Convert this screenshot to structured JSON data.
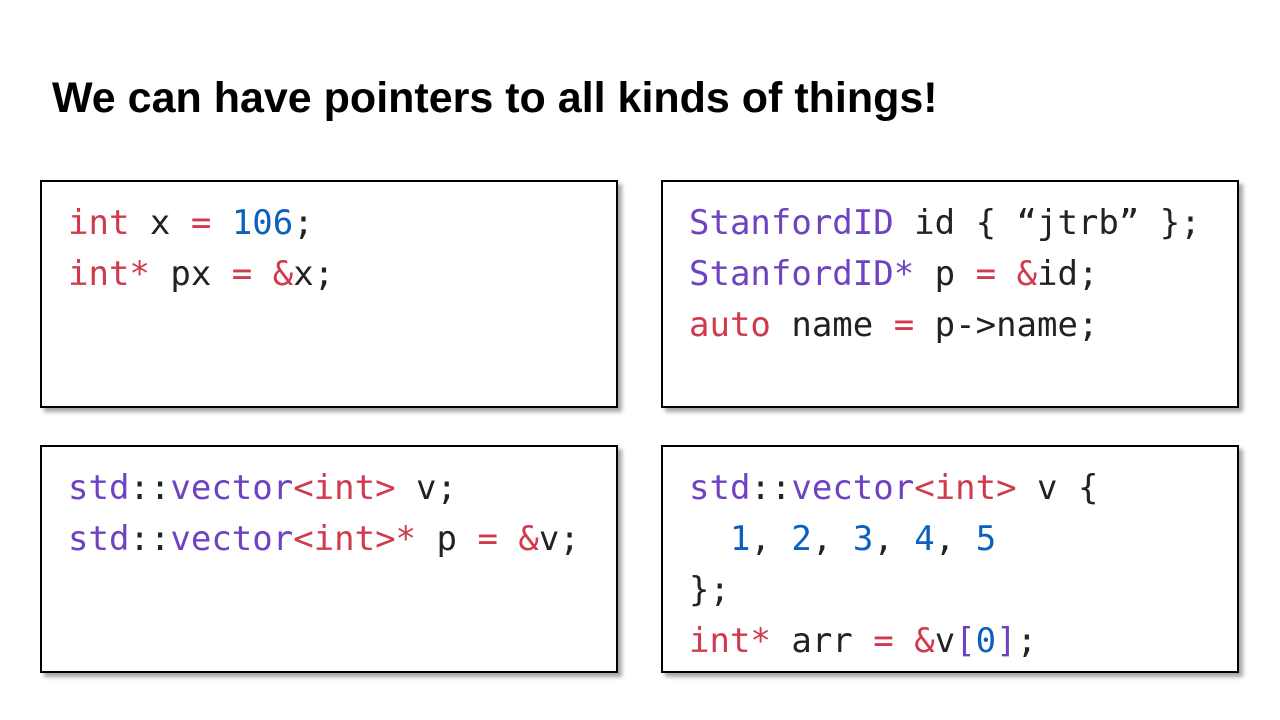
{
  "title": "We can have pointers to all kinds of things!",
  "colors": {
    "keyword": "#cf3a4c",
    "number": "#0b5fbe",
    "type": "#6f42c1",
    "plain": "#222222"
  },
  "boxes": [
    {
      "lines": [
        [
          [
            "int",
            "kw"
          ],
          [
            " x ",
            "plain"
          ],
          [
            "=",
            "kw"
          ],
          [
            " ",
            "plain"
          ],
          [
            "106",
            "num"
          ],
          [
            ";",
            "plain"
          ]
        ],
        [
          [
            "int*",
            "kw"
          ],
          [
            " px ",
            "plain"
          ],
          [
            "=",
            "kw"
          ],
          [
            " ",
            "plain"
          ],
          [
            "&",
            "kw"
          ],
          [
            "x;",
            "plain"
          ]
        ]
      ]
    },
    {
      "lines": [
        [
          [
            "StanfordID",
            "type"
          ],
          [
            " id { “jtrb” };",
            "plain"
          ]
        ],
        [
          [
            "StanfordID*",
            "type"
          ],
          [
            " p ",
            "plain"
          ],
          [
            "=",
            "kw"
          ],
          [
            " ",
            "plain"
          ],
          [
            "&",
            "kw"
          ],
          [
            "id;",
            "plain"
          ]
        ],
        [
          [
            "auto",
            "kw"
          ],
          [
            " name ",
            "plain"
          ],
          [
            "=",
            "kw"
          ],
          [
            " p->name;",
            "plain"
          ]
        ]
      ]
    },
    {
      "lines": [
        [
          [
            "std",
            "type"
          ],
          [
            "::",
            "plain"
          ],
          [
            "vector",
            "type"
          ],
          [
            "<int>",
            "kw"
          ],
          [
            " v;",
            "plain"
          ]
        ],
        [
          [
            "std",
            "type"
          ],
          [
            "::",
            "plain"
          ],
          [
            "vector",
            "type"
          ],
          [
            "<int>*",
            "kw"
          ],
          [
            " p ",
            "plain"
          ],
          [
            "=",
            "kw"
          ],
          [
            " ",
            "plain"
          ],
          [
            "&",
            "kw"
          ],
          [
            "v;",
            "plain"
          ]
        ]
      ]
    },
    {
      "lines": [
        [
          [
            "std",
            "type"
          ],
          [
            "::",
            "plain"
          ],
          [
            "vector",
            "type"
          ],
          [
            "<int>",
            "kw"
          ],
          [
            " v {",
            "plain"
          ]
        ],
        [
          [
            "  ",
            "plain"
          ],
          [
            "1",
            "num"
          ],
          [
            ", ",
            "plain"
          ],
          [
            "2",
            "num"
          ],
          [
            ", ",
            "plain"
          ],
          [
            "3",
            "num"
          ],
          [
            ", ",
            "plain"
          ],
          [
            "4",
            "num"
          ],
          [
            ", ",
            "plain"
          ],
          [
            "5",
            "num"
          ]
        ],
        [
          [
            "};",
            "plain"
          ]
        ],
        [
          [
            "int*",
            "kw"
          ],
          [
            " arr ",
            "plain"
          ],
          [
            "=",
            "kw"
          ],
          [
            " ",
            "plain"
          ],
          [
            "&",
            "kw"
          ],
          [
            "v",
            "plain"
          ],
          [
            "[",
            "type"
          ],
          [
            "0",
            "num"
          ],
          [
            "]",
            "type"
          ],
          [
            ";",
            "plain"
          ]
        ]
      ]
    }
  ]
}
